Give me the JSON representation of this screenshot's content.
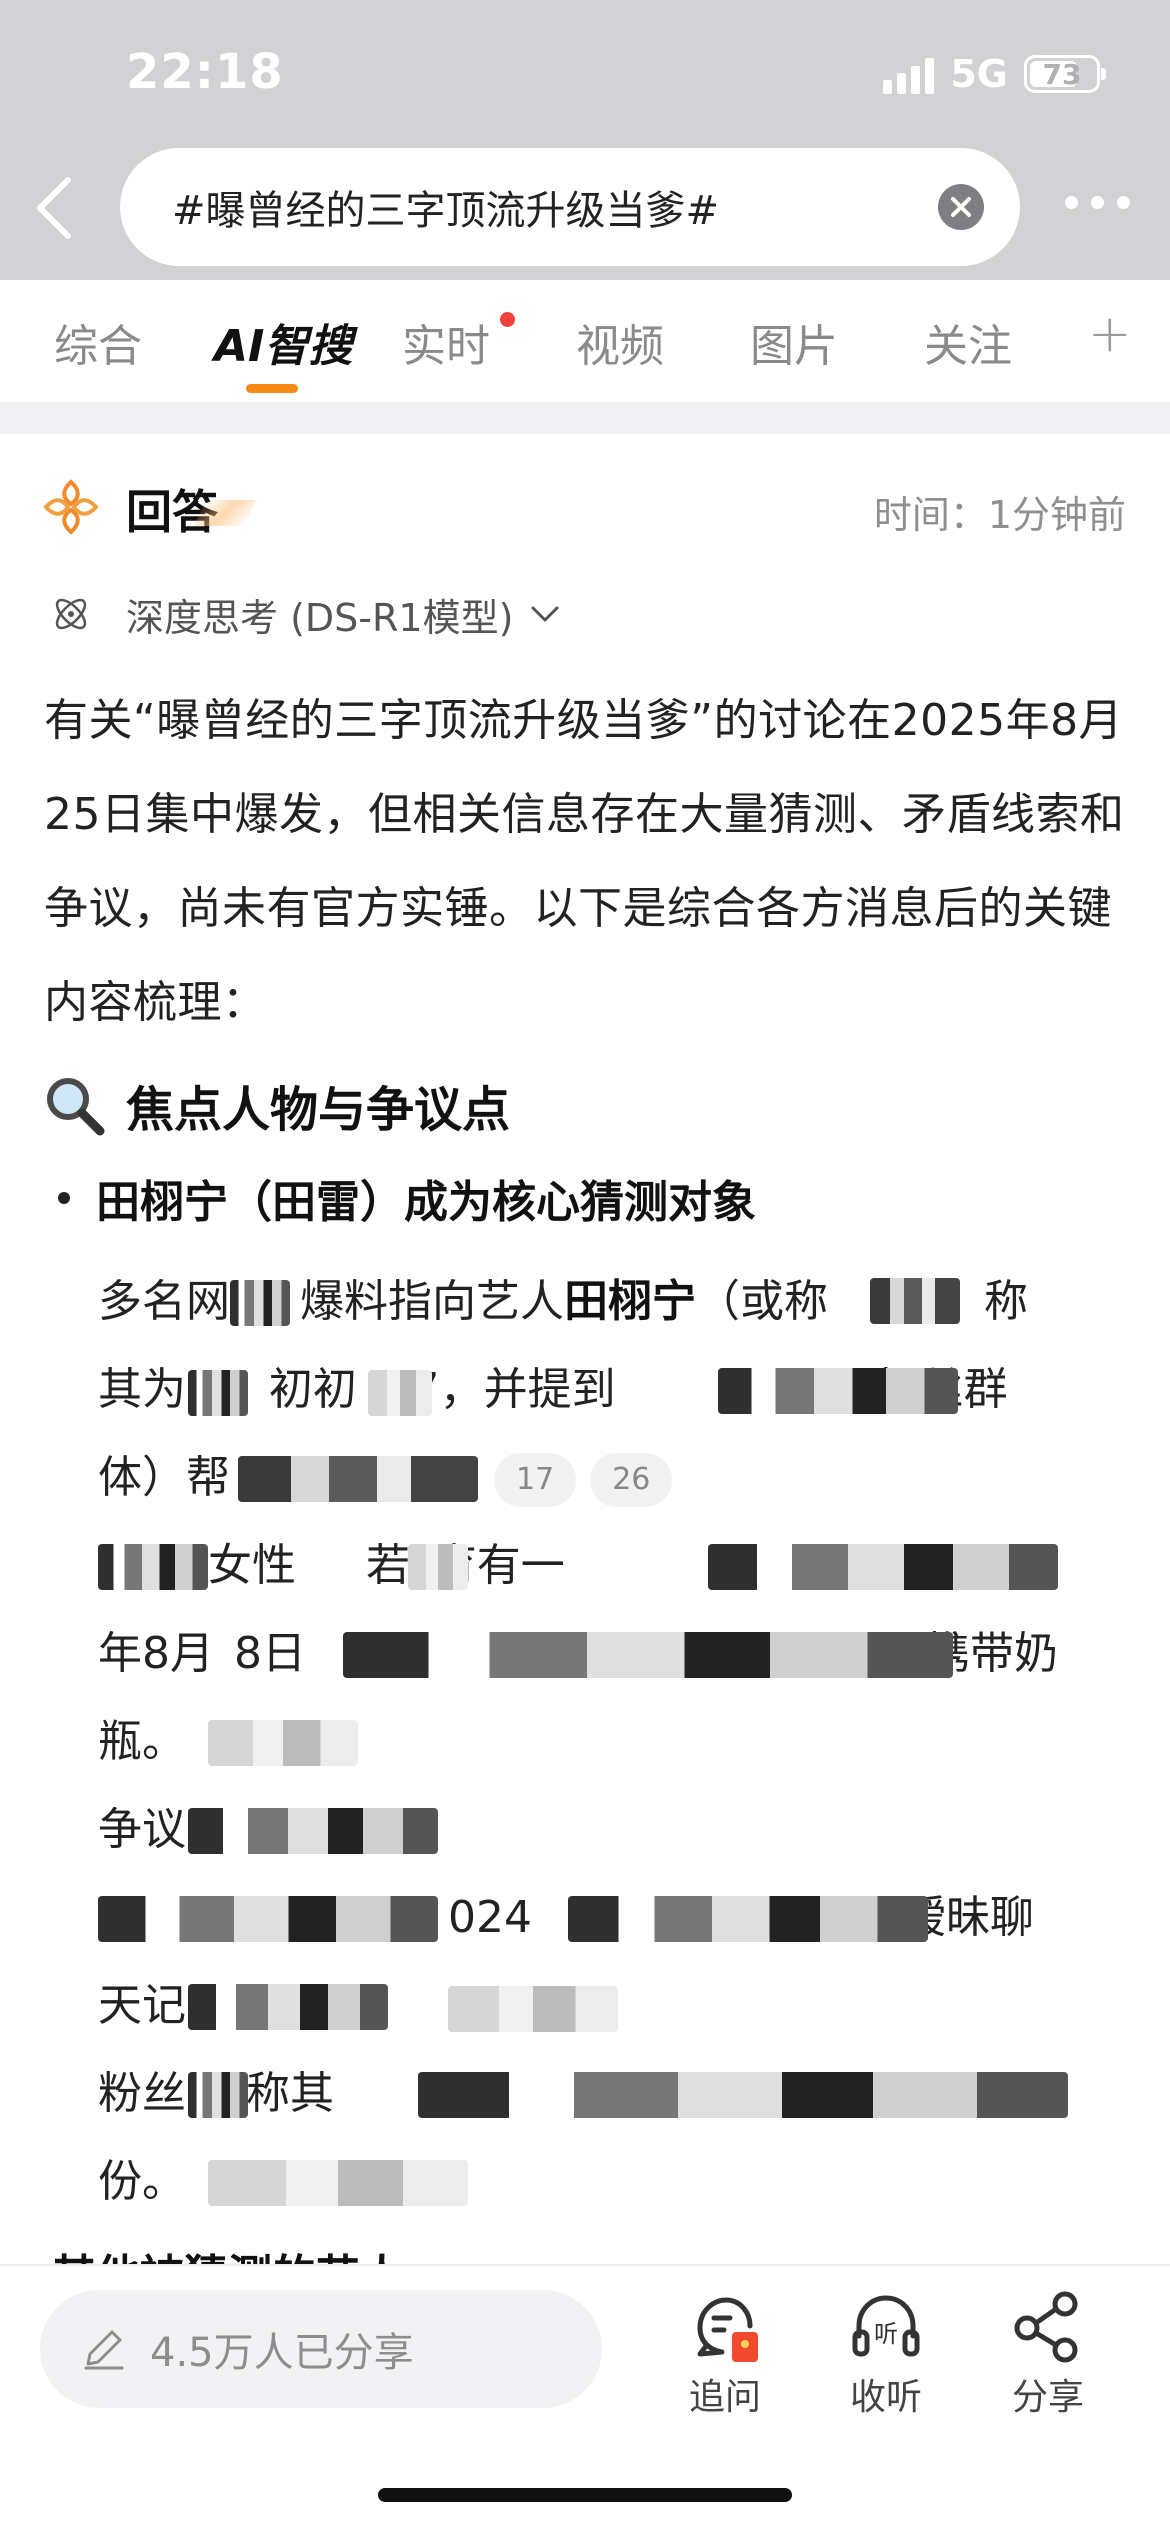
{
  "status_bar": {
    "time": "22:18",
    "network": "5G",
    "battery": "73",
    "battery_level": 0.73
  },
  "search": {
    "query": "#曝曾经的三字顶流升级当爹#"
  },
  "tabs": [
    {
      "label": "综合"
    },
    {
      "label": "AI智搜",
      "active": true
    },
    {
      "label": "实时",
      "dot": true
    },
    {
      "label": "视频"
    },
    {
      "label": "图片"
    },
    {
      "label": "关注"
    }
  ],
  "tab_add": "+",
  "answer": {
    "title": "回答",
    "time": "时间：1分钟前",
    "deep_think": "深度思考 (DS-R1模型)",
    "intro": "有关“曝曾经的三字顶流升级当爹”的讨论在2025年8月25日集中爆发，但相关信息存在大量猜测、矛盾线索和争议，尚未有官方实锤。以下是综合各方消息后的关键内容梳理：",
    "section_title": "焦点人物与争议点",
    "bullet": "田栩宁（田雷）成为核心猜测对象",
    "lines": [
      {
        "pre": "多名网",
        "bold": "",
        "mid": "爆料指向艺人",
        "name": "田栩宁",
        "post": "（或称",
        "end": "），称"
      },
      {
        "text": "其为“",
        "t2": "初初",
        "t3": "”，并提到",
        "t4": "粉丝群"
      },
      {
        "text": "体）帮",
        "cite1": "17",
        "cite2": "26"
      },
      {
        "text": "女性",
        "t2": "若”育有一",
        "t3": "24"
      },
      {
        "text": "年8月",
        "t2": "8日",
        "t3": "携带奶"
      },
      {
        "text": "瓶。"
      },
      {
        "text": "争议"
      },
      {
        "text": "024",
        "t2": "暧昧聊"
      },
      {
        "text": "天记"
      },
      {
        "text": "粉丝",
        "t2": "称其"
      },
      {
        "text": "份。"
      }
    ],
    "cut_text": "其他被猜测的艺人"
  },
  "bottom": {
    "share_count": "4.5万人已分享",
    "actions": [
      {
        "label": "追问",
        "icon": "follow-up-icon"
      },
      {
        "label": "收听",
        "icon": "headphones-icon"
      },
      {
        "label": "分享",
        "icon": "share-icon"
      }
    ]
  },
  "colors": {
    "accent": "#f58a14",
    "notification_dot": "#f2403a"
  }
}
